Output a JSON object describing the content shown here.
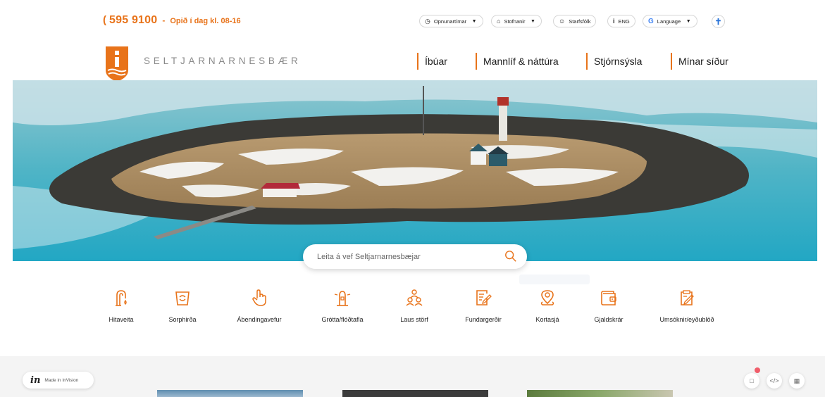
{
  "topbar": {
    "phone": "595 9100",
    "separator": "-",
    "hours": "Opið í dag kl. 08-16",
    "utilities": [
      {
        "label": "Opnunartímar",
        "icon": "clock-icon"
      },
      {
        "label": "Stofnanir",
        "icon": "home-icon"
      },
      {
        "label": "Starfsfólk",
        "icon": "person-icon"
      },
      {
        "label": "ENG",
        "icon": "info-icon"
      },
      {
        "label": "Language",
        "icon": "google-icon"
      }
    ]
  },
  "brand": {
    "name": "SELTJARNARNESBÆR"
  },
  "nav": {
    "items": [
      "Íbúar",
      "Mannlíf & náttúra",
      "Stjórnsýsla",
      "Mínar síður"
    ]
  },
  "search": {
    "placeholder": "Leita á vef Seltjarnarnesbæjar"
  },
  "quicklinks": [
    {
      "label": "Hitaveita",
      "icon": "hot-water-icon"
    },
    {
      "label": "Sorphirða",
      "icon": "recycle-bin-icon"
    },
    {
      "label": "Ábendingavefur",
      "icon": "pointer-hand-icon"
    },
    {
      "label": "Grótta/flóðtafla",
      "icon": "lighthouse-icon"
    },
    {
      "label": "Laus störf",
      "icon": "people-icon"
    },
    {
      "label": "Fundargerðir",
      "icon": "document-edit-icon"
    },
    {
      "label": "Kortasjá",
      "icon": "map-pin-icon"
    },
    {
      "label": "Gjaldskrár",
      "icon": "wallet-icon"
    },
    {
      "label": "Umsóknir/eyðublöð",
      "icon": "form-edit-icon"
    }
  ],
  "invision": {
    "logo": "in",
    "label": "Made in InVision"
  },
  "colors": {
    "accent": "#e8731a",
    "notification": "#f05d6a"
  }
}
